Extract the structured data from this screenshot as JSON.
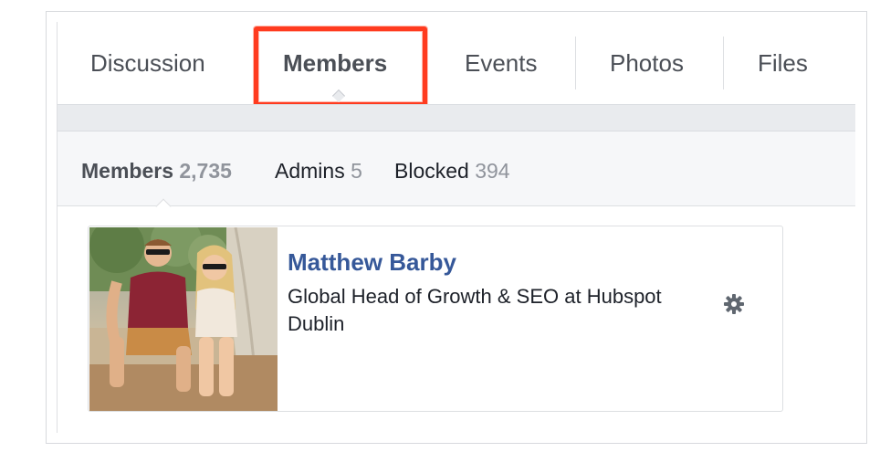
{
  "tabs": [
    {
      "label": "Discussion"
    },
    {
      "label": "Members"
    },
    {
      "label": "Events"
    },
    {
      "label": "Photos"
    },
    {
      "label": "Files"
    }
  ],
  "subnav": {
    "members_label": "Members",
    "members_count": "2,735",
    "admins_label": "Admins",
    "admins_count": "5",
    "blocked_label": "Blocked",
    "blocked_count": "394"
  },
  "member": {
    "name": "Matthew Barby",
    "title": "Global Head of Growth & SEO at Hubspot",
    "location": "Dublin",
    "settings_icon": "gear-icon"
  },
  "colors": {
    "highlight": "#ff3b1f",
    "link": "#365899",
    "muted": "#90949c"
  }
}
